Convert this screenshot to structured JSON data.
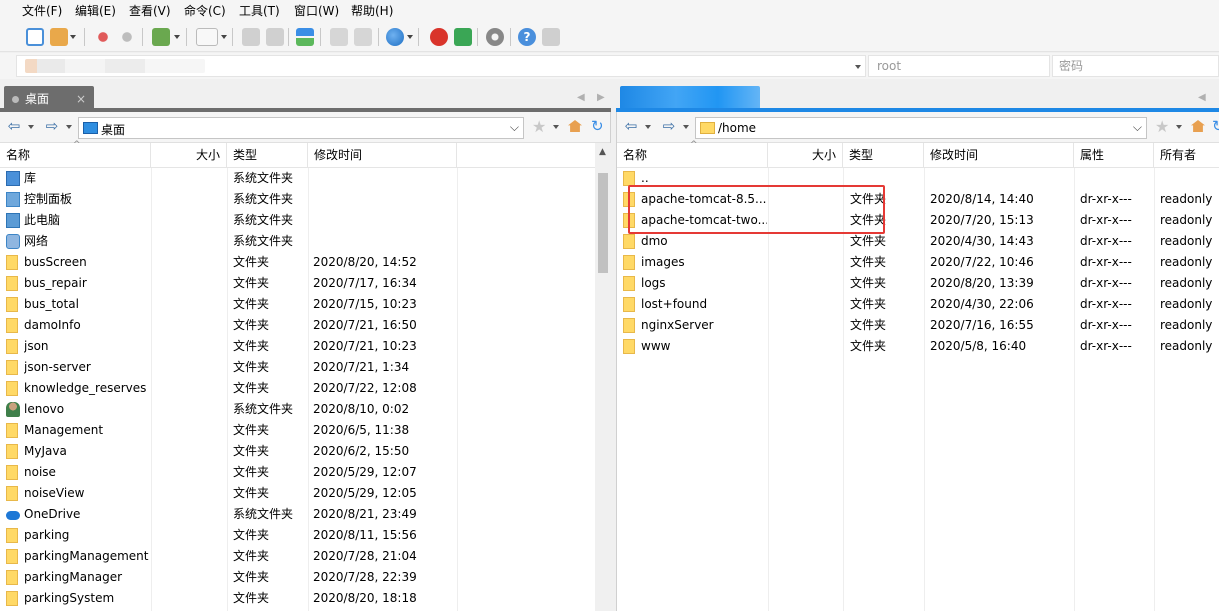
{
  "menu": [
    "文件(F)",
    "编辑(E)",
    "查看(V)",
    "命令(C)",
    "工具(T)",
    "窗口(W)",
    "帮助(H)"
  ],
  "address": {
    "user_value": "root",
    "password_placeholder": "密码"
  },
  "tabs": {
    "left_label": "桌面",
    "left_close": "×"
  },
  "left": {
    "path": "桌面",
    "columns": [
      "名称",
      "大小",
      "类型",
      "修改时间"
    ],
    "rows": [
      {
        "name": "库",
        "size": "",
        "type": "系统文件夹",
        "mtime": "",
        "icon": "library-icon"
      },
      {
        "name": "控制面板",
        "size": "",
        "type": "系统文件夹",
        "mtime": "",
        "icon": "control-panel-icon"
      },
      {
        "name": "此电脑",
        "size": "",
        "type": "系统文件夹",
        "mtime": "",
        "icon": "computer-icon"
      },
      {
        "name": "网络",
        "size": "",
        "type": "系统文件夹",
        "mtime": "",
        "icon": "network-icon"
      },
      {
        "name": "busScreen",
        "size": "",
        "type": "文件夹",
        "mtime": "2020/8/20, 14:52",
        "icon": "folder-icon"
      },
      {
        "name": "bus_repair",
        "size": "",
        "type": "文件夹",
        "mtime": "2020/7/17, 16:34",
        "icon": "folder-icon"
      },
      {
        "name": "bus_total",
        "size": "",
        "type": "文件夹",
        "mtime": "2020/7/15, 10:23",
        "icon": "folder-icon"
      },
      {
        "name": "damoInfo",
        "size": "",
        "type": "文件夹",
        "mtime": "2020/7/21, 16:50",
        "icon": "folder-icon"
      },
      {
        "name": "json",
        "size": "",
        "type": "文件夹",
        "mtime": "2020/7/21, 10:23",
        "icon": "folder-icon"
      },
      {
        "name": "json-server",
        "size": "",
        "type": "文件夹",
        "mtime": "2020/7/21, 1:34",
        "icon": "folder-icon"
      },
      {
        "name": "knowledge_reserves",
        "size": "",
        "type": "文件夹",
        "mtime": "2020/7/22, 12:08",
        "icon": "folder-icon"
      },
      {
        "name": "lenovo",
        "size": "",
        "type": "系统文件夹",
        "mtime": "2020/8/10, 0:02",
        "icon": "user-icon"
      },
      {
        "name": "Management",
        "size": "",
        "type": "文件夹",
        "mtime": "2020/6/5, 11:38",
        "icon": "folder-icon"
      },
      {
        "name": "MyJava",
        "size": "",
        "type": "文件夹",
        "mtime": "2020/6/2, 15:50",
        "icon": "folder-icon"
      },
      {
        "name": "noise",
        "size": "",
        "type": "文件夹",
        "mtime": "2020/5/29, 12:07",
        "icon": "folder-icon"
      },
      {
        "name": "noiseView",
        "size": "",
        "type": "文件夹",
        "mtime": "2020/5/29, 12:05",
        "icon": "folder-icon"
      },
      {
        "name": "OneDrive",
        "size": "",
        "type": "系统文件夹",
        "mtime": "2020/8/21, 23:49",
        "icon": "onedrive-icon"
      },
      {
        "name": "parking",
        "size": "",
        "type": "文件夹",
        "mtime": "2020/8/11, 15:56",
        "icon": "folder-icon"
      },
      {
        "name": "parkingManagement",
        "size": "",
        "type": "文件夹",
        "mtime": "2020/7/28, 21:04",
        "icon": "folder-icon"
      },
      {
        "name": "parkingManager",
        "size": "",
        "type": "文件夹",
        "mtime": "2020/7/28, 22:39",
        "icon": "folder-icon"
      },
      {
        "name": "parkingSystem",
        "size": "",
        "type": "文件夹",
        "mtime": "2020/8/20, 18:18",
        "icon": "folder-icon"
      }
    ]
  },
  "right": {
    "path": "/home",
    "columns": [
      "名称",
      "大小",
      "类型",
      "修改时间",
      "属性",
      "所有者"
    ],
    "rows": [
      {
        "name": "..",
        "size": "",
        "type": "",
        "mtime": "",
        "attr": "",
        "owner": ""
      },
      {
        "name": "apache-tomcat-8.5....",
        "size": "",
        "type": "文件夹",
        "mtime": "2020/8/14, 14:40",
        "attr": "dr-xr-x---",
        "owner": "readonly"
      },
      {
        "name": "apache-tomcat-two....",
        "size": "",
        "type": "文件夹",
        "mtime": "2020/7/20, 15:13",
        "attr": "dr-xr-x---",
        "owner": "readonly"
      },
      {
        "name": "dmo",
        "size": "",
        "type": "文件夹",
        "mtime": "2020/4/30, 14:43",
        "attr": "dr-xr-x---",
        "owner": "readonly"
      },
      {
        "name": "images",
        "size": "",
        "type": "文件夹",
        "mtime": "2020/7/22, 10:46",
        "attr": "dr-xr-x---",
        "owner": "readonly"
      },
      {
        "name": "logs",
        "size": "",
        "type": "文件夹",
        "mtime": "2020/8/20, 13:39",
        "attr": "dr-xr-x---",
        "owner": "readonly"
      },
      {
        "name": "lost+found",
        "size": "",
        "type": "文件夹",
        "mtime": "2020/4/30, 22:06",
        "attr": "dr-xr-x---",
        "owner": "readonly"
      },
      {
        "name": "nginxServer",
        "size": "",
        "type": "文件夹",
        "mtime": "2020/7/16, 16:55",
        "attr": "dr-xr-x---",
        "owner": "readonly"
      },
      {
        "name": "www",
        "size": "",
        "type": "文件夹",
        "mtime": "2020/5/8, 16:40",
        "attr": "dr-xr-x---",
        "owner": "readonly"
      }
    ]
  },
  "colors": {
    "left_tab": "#6d6d6d",
    "right_tab": "#1e88e5",
    "highlight_box": "#e53935",
    "folder": "#ffd966"
  }
}
